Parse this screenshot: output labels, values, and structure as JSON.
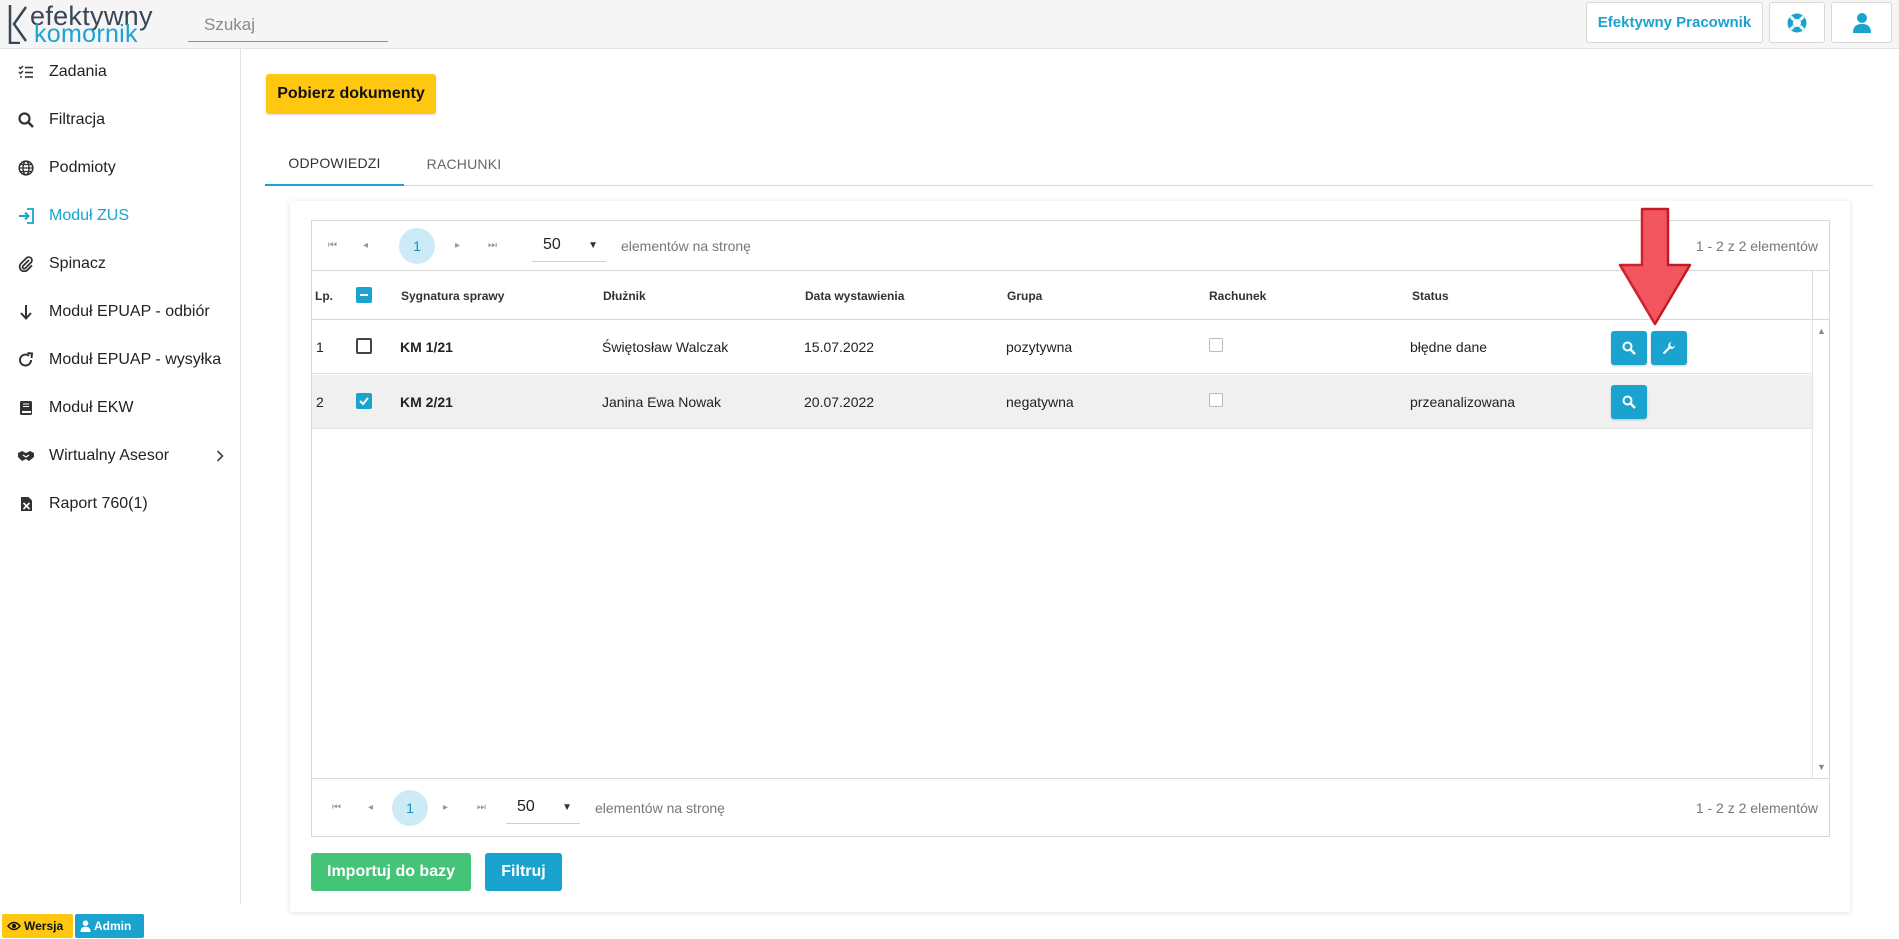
{
  "app": {
    "logo_line1": "efektywny",
    "logo_line2": "komornik",
    "search_placeholder": "Szukaj",
    "worker_button": "Efektywny Pracownik"
  },
  "sidebar": {
    "items": [
      {
        "label": "Zadania",
        "icon": "tasks-icon"
      },
      {
        "label": "Filtracja",
        "icon": "search-icon"
      },
      {
        "label": "Podmioty",
        "icon": "globe-icon"
      },
      {
        "label": "Moduł ZUS",
        "icon": "sign-in-icon",
        "active": true
      },
      {
        "label": "Spinacz",
        "icon": "paperclip-icon"
      },
      {
        "label": "Moduł EPUAP - odbiór",
        "icon": "arrow-down-icon"
      },
      {
        "label": "Moduł EPUAP - wysyłka",
        "icon": "redo-icon"
      },
      {
        "label": "Moduł EKW",
        "icon": "book-icon"
      },
      {
        "label": "Wirtualny Asesor",
        "icon": "handshake-icon"
      },
      {
        "label": "Raport 760(1)",
        "icon": "excel-file-icon"
      }
    ]
  },
  "main": {
    "download_button": "Pobierz dokumenty",
    "tabs": [
      {
        "label": "ODPOWIEDZI",
        "active": true
      },
      {
        "label": "RACHUNKI",
        "active": false
      }
    ],
    "pager": {
      "page": "1",
      "page_size": "50",
      "per_page_text": "elementów na stronę",
      "info": "1 - 2 z 2 elementów"
    },
    "columns": [
      "Lp.",
      "Sygnatura sprawy",
      "Dłużnik",
      "Data wystawienia",
      "Grupa",
      "Rachunek",
      "Status"
    ],
    "rows": [
      {
        "lp": "1",
        "selected": false,
        "signature": "KM 1/21",
        "debtor": "Świętosław Walczak",
        "date": "15.07.2022",
        "group": "pozytywna",
        "account": false,
        "status": "błędne dane",
        "actions": [
          "search",
          "wrench"
        ]
      },
      {
        "lp": "2",
        "selected": true,
        "signature": "KM 2/21",
        "debtor": "Janina Ewa Nowak",
        "date": "20.07.2022",
        "group": "negatywna",
        "account": false,
        "status": "przeanalizowana",
        "actions": [
          "search"
        ]
      }
    ],
    "import_button": "Importuj do bazy",
    "filter_button": "Filtruj"
  },
  "footer": {
    "version_badge": "Wersja",
    "admin_badge": "Admin"
  },
  "colors": {
    "accent": "#1aa3cf",
    "yellow": "#ffc710",
    "green": "#43c477",
    "arrow_red": "#f05560"
  }
}
